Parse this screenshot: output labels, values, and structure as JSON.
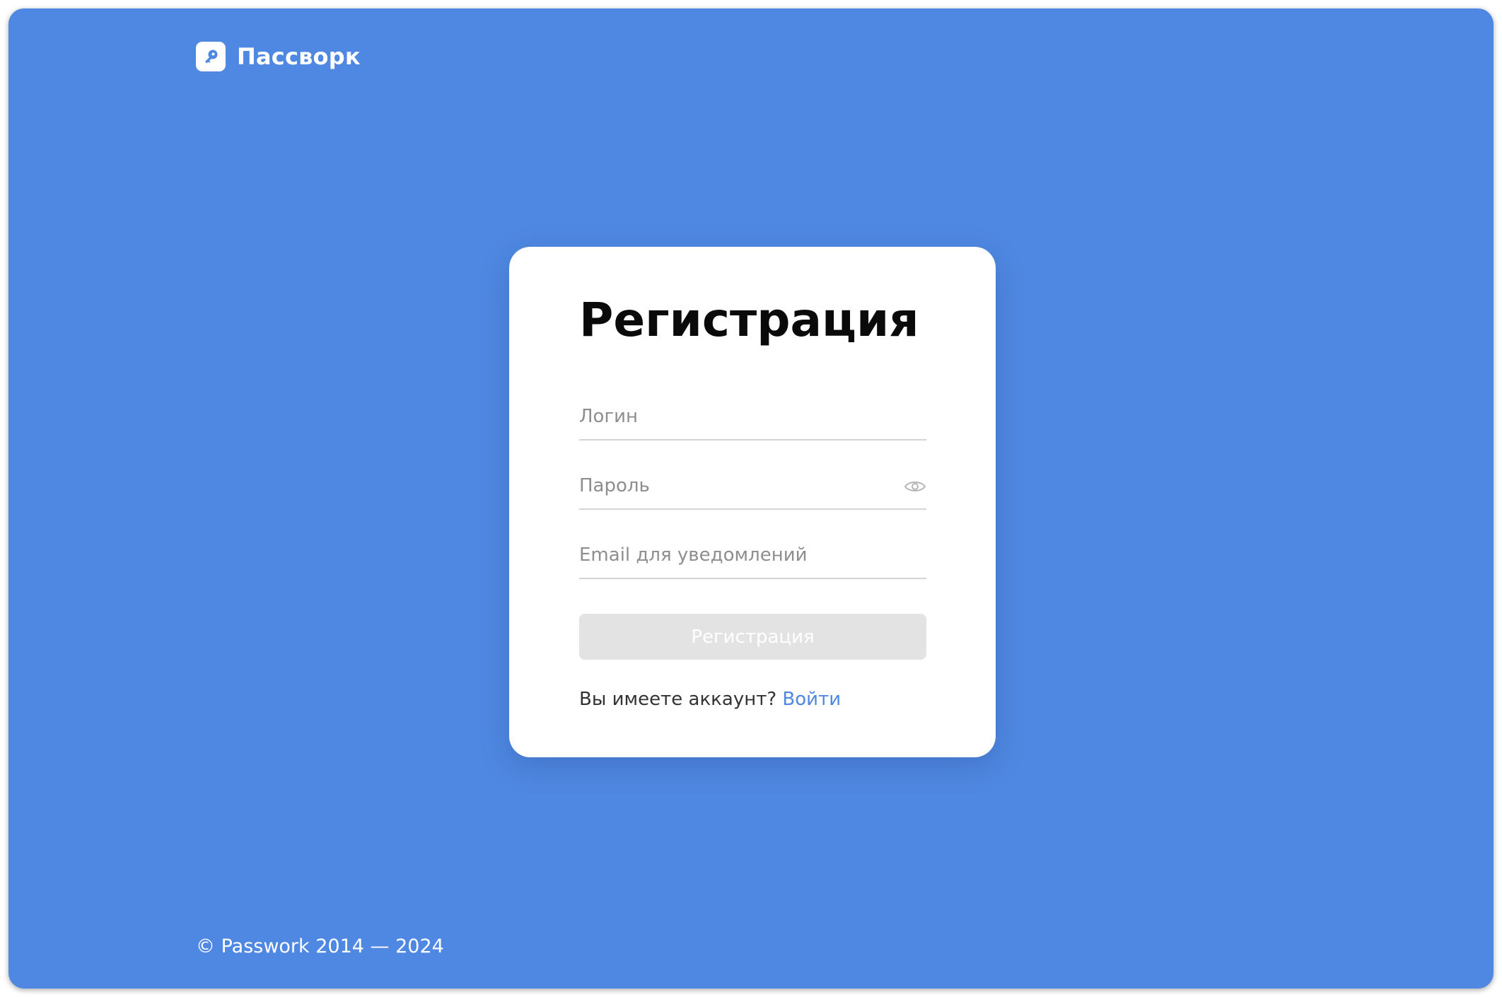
{
  "brand": {
    "name": "Пассворк",
    "icon": "key-icon",
    "background_color": "#4f88e2"
  },
  "form": {
    "title": "Регистрация",
    "login_placeholder": "Логин",
    "password_placeholder": "Пароль",
    "password_toggle_icon": "eye-icon",
    "email_placeholder": "Email для уведомлений",
    "submit_label": "Регистрация",
    "account_prompt": "Вы имеете аккаунт?",
    "signin_link": "Войти",
    "accent_color": "#4f88e2",
    "submit_disabled_color": "#e3e3e3"
  },
  "footer": {
    "copyright": "© Passwork 2014 — 2024"
  }
}
